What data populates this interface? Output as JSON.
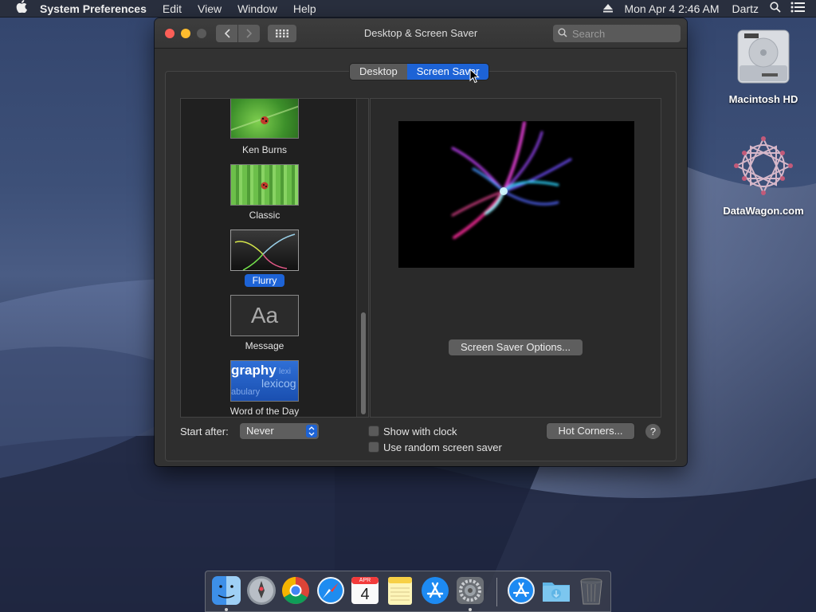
{
  "menubar": {
    "app_name": "System Preferences",
    "menus": [
      "Edit",
      "View",
      "Window",
      "Help"
    ],
    "datetime": "Mon Apr 4  2:46 AM",
    "user": "Dartz",
    "icons": [
      "apple-icon",
      "eject-icon",
      "spotlight-search-icon",
      "notification-center-icon"
    ]
  },
  "window": {
    "title": "Desktop & Screen Saver",
    "search_placeholder": "Search",
    "tabs": [
      {
        "label": "Desktop",
        "active": false
      },
      {
        "label": "Screen Saver",
        "active": true
      }
    ]
  },
  "screen_savers": [
    {
      "label": "Ken Burns",
      "selected": false
    },
    {
      "label": "Classic",
      "selected": false
    },
    {
      "label": "Flurry",
      "selected": true
    },
    {
      "label": "Message",
      "selected": false,
      "thumb_text": "Aa"
    },
    {
      "label": "Word of the Day",
      "selected": false,
      "thumb_words": [
        "graphy",
        "lexicog",
        "abulary",
        "lexi"
      ]
    }
  ],
  "preview": {
    "options_button": "Screen Saver Options..."
  },
  "controls": {
    "start_after_label": "Start after:",
    "start_after_value": "Never",
    "show_with_clock": {
      "label": "Show with clock",
      "checked": false
    },
    "random_screen_saver": {
      "label": "Use random screen saver",
      "checked": false
    },
    "hot_corners_button": "Hot Corners...",
    "help_button": "?"
  },
  "desktop_icons": [
    {
      "label": "Macintosh HD",
      "icon": "hard-drive-icon"
    },
    {
      "label": "DataWagon.com",
      "icon": "network-share-icon"
    }
  ],
  "dock": {
    "items": [
      "finder",
      "launchpad",
      "chrome",
      "safari",
      "calendar",
      "notes",
      "app-store",
      "system-preferences",
      "app-store-downloads",
      "downloads-folder",
      "trash"
    ],
    "calendar_month": "APR",
    "calendar_day": "4"
  },
  "colors": {
    "accent": "#1d63d6",
    "window_bg": "#323232",
    "close": "#fc5f57",
    "minimize": "#fdbc2e"
  }
}
